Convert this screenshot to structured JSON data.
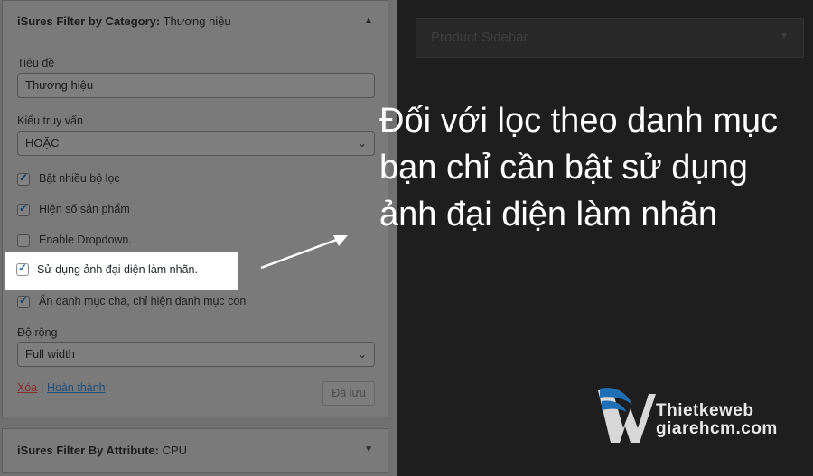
{
  "widget_category": {
    "title_prefix": "iSures Filter by Category:",
    "title_value": "Thương hiệu",
    "collapse_icon": "caret-up-icon",
    "title_label": "Tiêu đề",
    "title_input_value": "Thương hiệu",
    "query_label": "Kiểu truy vấn",
    "query_value": "HOẶC",
    "checkboxes": [
      {
        "label": "Bật nhiều bộ lọc",
        "checked": true
      },
      {
        "label": "Hiện số sản phẩm",
        "checked": true
      },
      {
        "label": "Enable Dropdown.",
        "checked": false
      },
      {
        "label": "Sử dụng ảnh đại diện làm nhãn.",
        "checked": true
      },
      {
        "label": "Ẩn danh mục cha, chỉ hiện danh mục con",
        "checked": true
      }
    ],
    "width_label": "Độ rộng",
    "width_value": "Full width",
    "delete_link": "Xóa",
    "separator": "|",
    "done_link": "Hoàn thành",
    "save_button": "Đã lưu"
  },
  "widget_attribute": {
    "title_prefix": "iSures Filter By Attribute:",
    "title_value": "CPU",
    "expand_icon": "caret-down-icon"
  },
  "product_sidebar": {
    "title": "Product Sidebar",
    "expand_icon": "caret-down-icon"
  },
  "callout": {
    "text": "Đối với lọc theo danh mục bạn chỉ cần bật sử dụng ảnh đại diện làm nhãn"
  },
  "brand": {
    "line1": "Thietkeweb",
    "line2": "giarehcm.com"
  },
  "colors": {
    "highlight_bg": "#ffffff",
    "checkbox_accent": "#2271b1",
    "link": "#2271b1",
    "delete_link": "#b32d2e",
    "logo_blue": "#1e6fb3"
  }
}
